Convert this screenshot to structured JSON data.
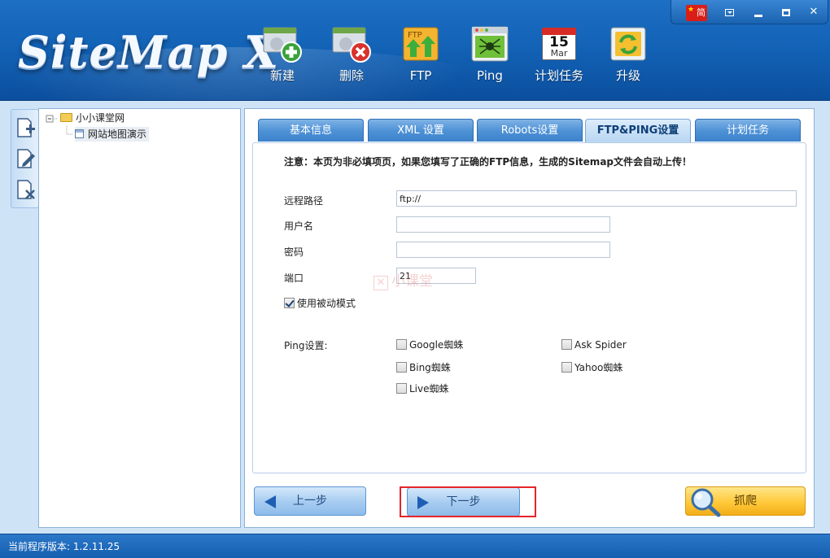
{
  "app": {
    "logo_text": "SiteMap X"
  },
  "toolbar": {
    "items": [
      {
        "label": "新建",
        "icon": "add-site-icon"
      },
      {
        "label": "删除",
        "icon": "delete-site-icon"
      },
      {
        "label": "FTP",
        "icon": "ftp-upload-icon"
      },
      {
        "label": "Ping",
        "icon": "ping-spider-icon"
      },
      {
        "label": "计划任务",
        "icon": "calendar-icon"
      },
      {
        "label": "升级",
        "icon": "refresh-icon"
      }
    ],
    "calendar_day": "15",
    "calendar_month": "Mar",
    "ftp_icon_text": "FTP"
  },
  "window_controls": {
    "language_label": "简",
    "icons": [
      "china-flag-icon",
      "dropdown-icon",
      "minimize-icon",
      "maximize-icon",
      "close-icon"
    ]
  },
  "side_tools": [
    "add-page-icon",
    "edit-page-icon",
    "delete-page-icon"
  ],
  "tree": {
    "root_label": "小小课堂网",
    "child_label": "网站地图演示"
  },
  "tabs": [
    {
      "label": "基本信息",
      "active": false
    },
    {
      "label": "XML 设置",
      "active": false
    },
    {
      "label": "Robots设置",
      "active": false
    },
    {
      "label": "FTP&PING设置",
      "active": true
    },
    {
      "label": "计划任务",
      "active": false
    }
  ],
  "form": {
    "notice": "注意：本页为非必填项页，如果您填写了正确的FTP信息，生成的Sitemap文件会自动上传！",
    "remote_path_label": "远程路径",
    "remote_path_value": "ftp://",
    "username_label": "用户名",
    "username_value": "",
    "password_label": "密码",
    "password_value": "",
    "port_label": "端口",
    "port_value": "21",
    "passive_mode_label": "使用被动模式",
    "passive_mode_checked": true,
    "ping_label": "Ping设置:",
    "spiders": [
      {
        "label": "Google蜘蛛",
        "checked": false
      },
      {
        "label": "Ask Spider",
        "checked": false
      },
      {
        "label": "Bing蜘蛛",
        "checked": false
      },
      {
        "label": "Yahoo蜘蛛",
        "checked": false
      },
      {
        "label": "Live蜘蛛",
        "checked": false
      }
    ]
  },
  "watermark": "小课堂",
  "buttons": {
    "prev_label": "上一步",
    "next_label": "下一步",
    "crawl_label": "抓爬"
  },
  "status": {
    "version_text": "当前程序版本: 1.2.11.25"
  },
  "colors": {
    "header_blue": "#1363b7",
    "highlight_red": "#e5252a",
    "crawl_yellow": "#ffc93a"
  }
}
